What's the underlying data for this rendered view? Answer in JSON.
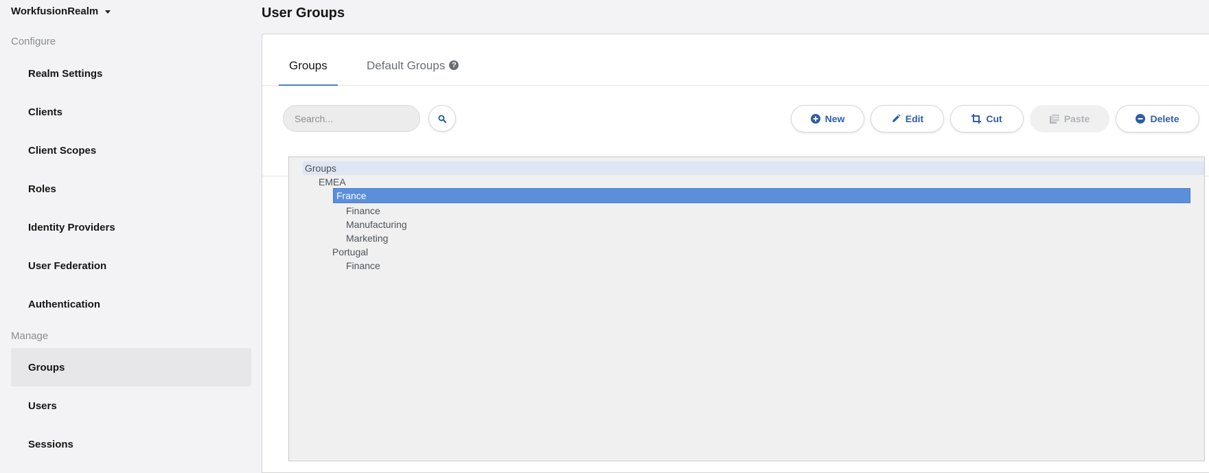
{
  "sidebar": {
    "realm_name": "WorkfusionRealm",
    "configure_label": "Configure",
    "manage_label": "Manage",
    "configure_items": [
      {
        "label": "Realm Settings"
      },
      {
        "label": "Clients"
      },
      {
        "label": "Client Scopes"
      },
      {
        "label": "Roles"
      },
      {
        "label": "Identity Providers"
      },
      {
        "label": "User Federation"
      },
      {
        "label": "Authentication"
      }
    ],
    "manage_items": [
      {
        "label": "Groups",
        "active": true
      },
      {
        "label": "Users"
      },
      {
        "label": "Sessions"
      }
    ]
  },
  "page": {
    "title": "User Groups"
  },
  "tabs": [
    {
      "label": "Groups",
      "active": true
    },
    {
      "label": "Default Groups",
      "icon": "help-icon"
    }
  ],
  "toolbar": {
    "search_placeholder": "Search...",
    "search_icon": "search-icon",
    "buttons": [
      {
        "label": "New",
        "icon": "plus-circle-icon",
        "enabled": true
      },
      {
        "label": "Edit",
        "icon": "pencil-icon",
        "enabled": true
      },
      {
        "label": "Cut",
        "icon": "crop-icon",
        "enabled": true
      },
      {
        "label": "Paste",
        "icon": "paste-icon",
        "enabled": false
      },
      {
        "label": "Delete",
        "icon": "minus-circle-icon",
        "enabled": true
      }
    ]
  },
  "tree": {
    "nodes": [
      {
        "label": "Groups",
        "level": 0,
        "root": true
      },
      {
        "label": "EMEA",
        "level": 1
      },
      {
        "label": "France",
        "level": 2,
        "selected": true
      },
      {
        "label": "Finance",
        "level": 3
      },
      {
        "label": "Manufacturing",
        "level": 3
      },
      {
        "label": "Marketing",
        "level": 3
      },
      {
        "label": "Portugal",
        "level": 2
      },
      {
        "label": "Finance",
        "level": 3
      }
    ]
  },
  "colors": {
    "accent": "#4a7fc9",
    "selected_node": "#5b8fdc",
    "button_text": "#2d5ea8"
  }
}
